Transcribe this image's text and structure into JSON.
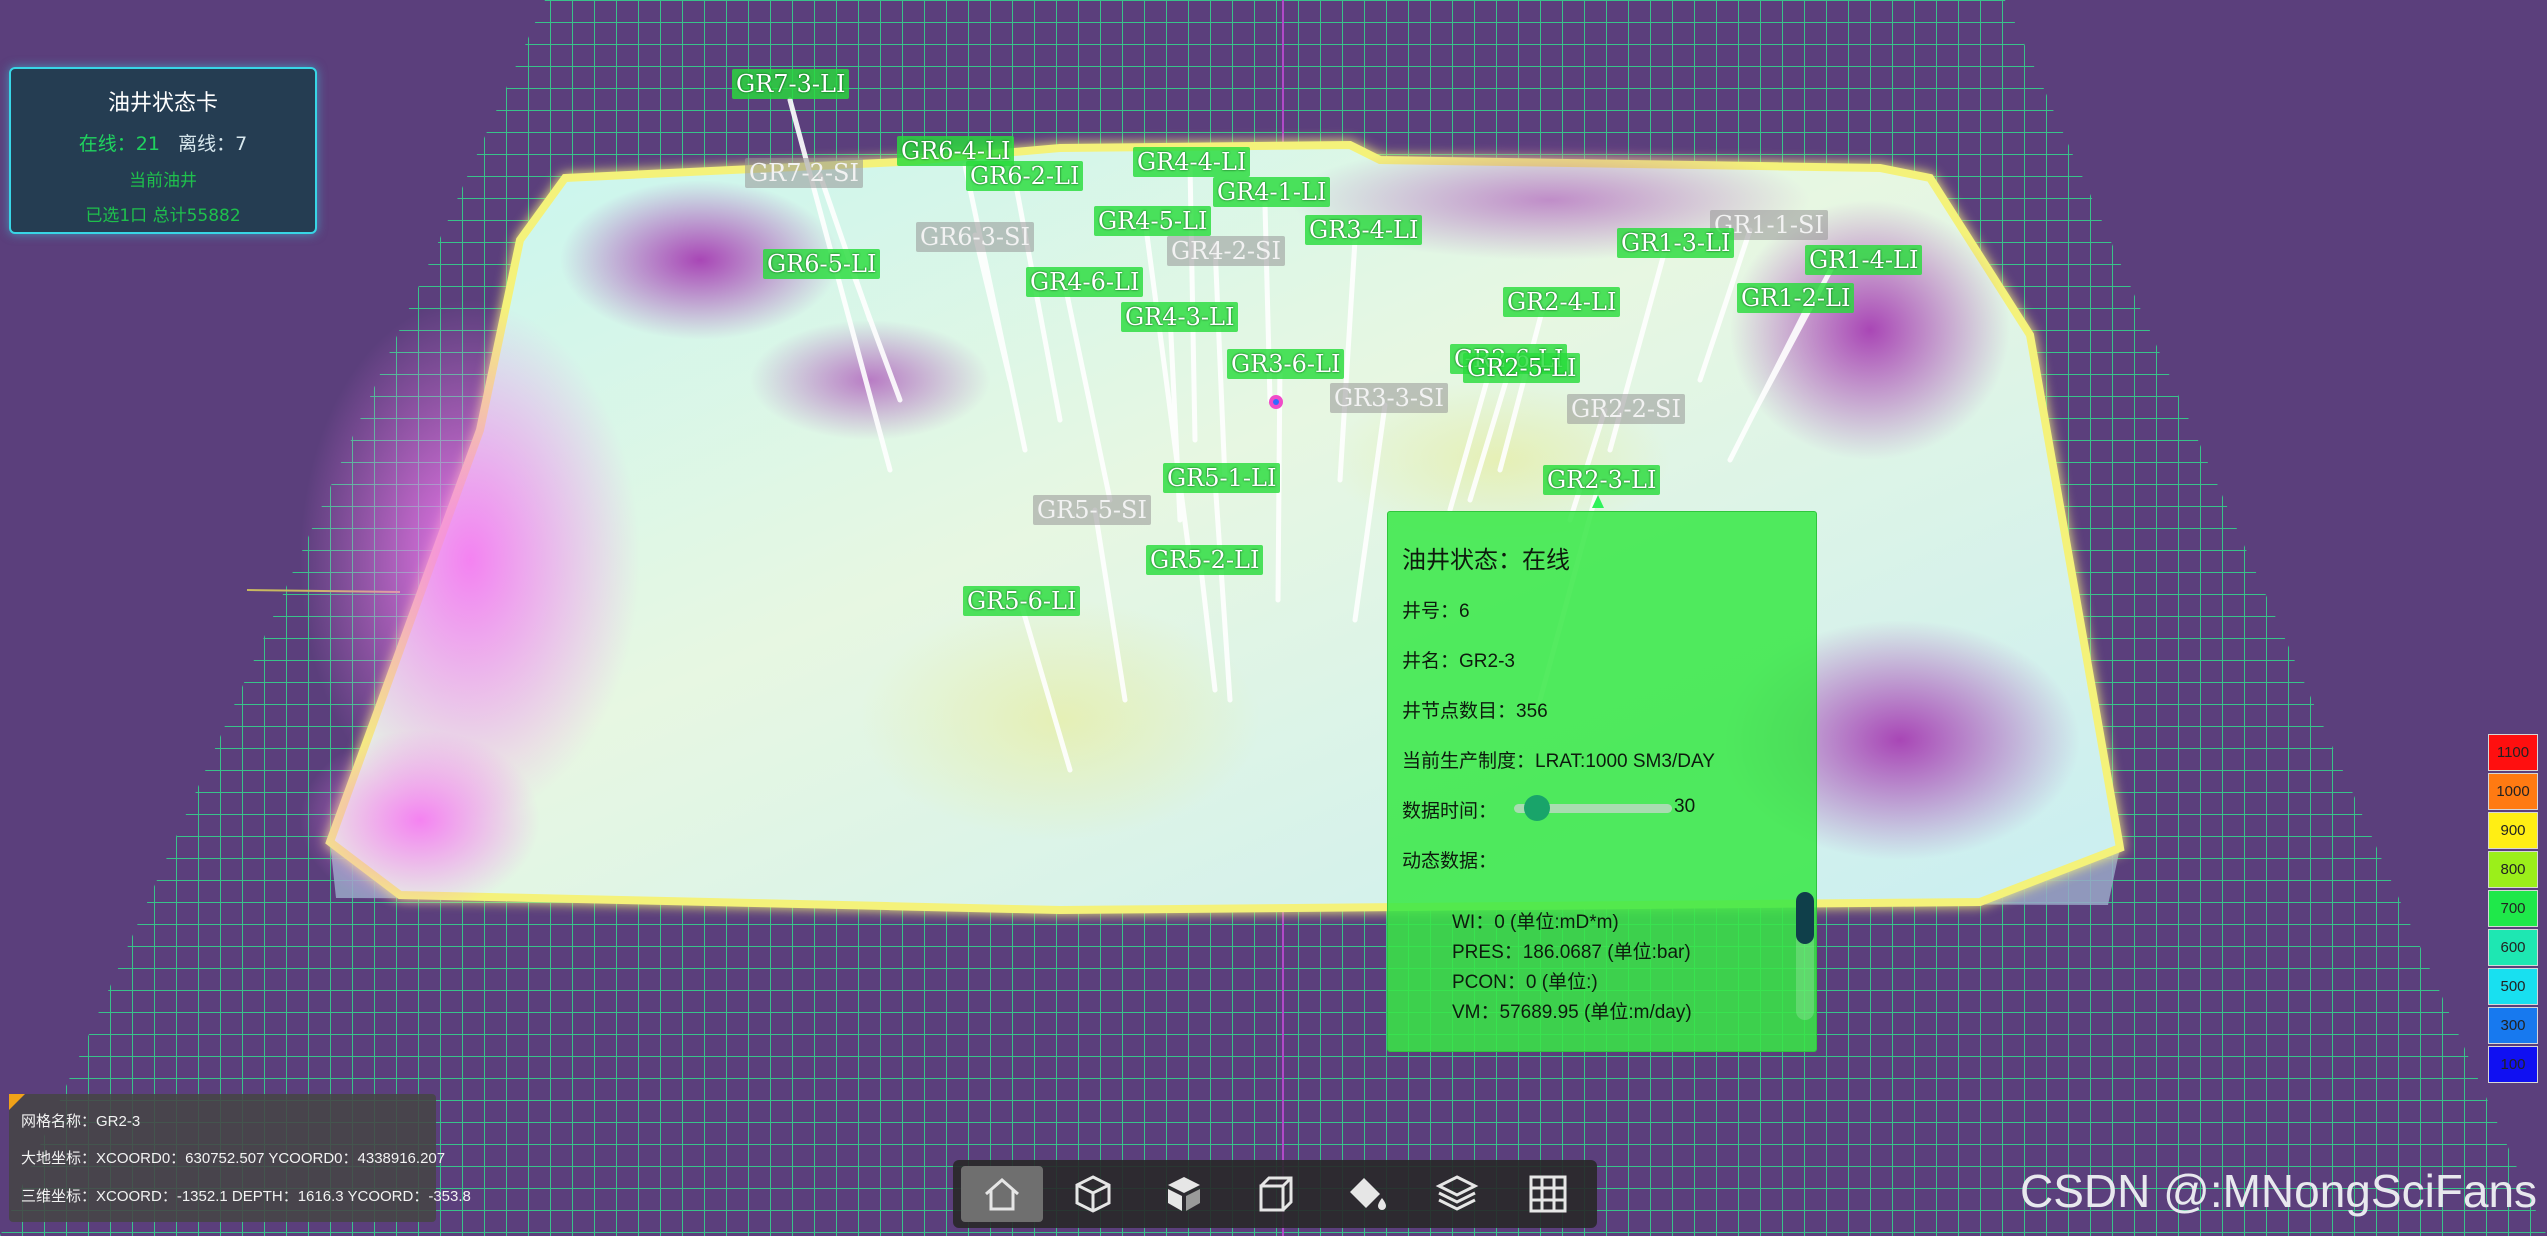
{
  "status_card": {
    "title": "油井状态卡",
    "online_label": "在线：",
    "online_count": "21",
    "offline_label": "离线：",
    "offline_count": "7",
    "line2": "当前油井",
    "line3": "已选1口  总计55882"
  },
  "well_labels": [
    {
      "name": "GR7-3-LI",
      "style": "lg"
    },
    {
      "name": "GR7-2-SI",
      "style": "sg"
    },
    {
      "name": "GR6-4-LI",
      "style": "lg"
    },
    {
      "name": "GR6-2-LI",
      "style": "lg"
    },
    {
      "name": "GR6-3-SI",
      "style": "sg"
    },
    {
      "name": "GR6-5-LI",
      "style": "lg"
    },
    {
      "name": "GR4-4-LI",
      "style": "lg"
    },
    {
      "name": "GR4-1-LI",
      "style": "lg"
    },
    {
      "name": "GR4-5-LI",
      "style": "lg"
    },
    {
      "name": "GR4-2-SI",
      "style": "sg"
    },
    {
      "name": "GR3-4-LI",
      "style": "lg"
    },
    {
      "name": "GR4-6-LI",
      "style": "lg"
    },
    {
      "name": "GR4-3-LI",
      "style": "lg"
    },
    {
      "name": "GR3-6-LI",
      "style": "lg"
    },
    {
      "name": "GR3-3-SI",
      "style": "sg"
    },
    {
      "name": "GR1-1-SI",
      "style": "sg"
    },
    {
      "name": "GR1-3-LI",
      "style": "lg"
    },
    {
      "name": "GR1-4-LI",
      "style": "lg"
    },
    {
      "name": "GR1-2-LI",
      "style": "lg"
    },
    {
      "name": "GR2-4-LI",
      "style": "lg"
    },
    {
      "name": "GR2-6-LI",
      "style": "lg"
    },
    {
      "name": "GR2-5-LI",
      "style": "lg"
    },
    {
      "name": "GR2-2-SI",
      "style": "sg"
    },
    {
      "name": "GR2-3-LI",
      "style": "lg"
    },
    {
      "name": "GR5-1-LI",
      "style": "lg"
    },
    {
      "name": "GR5-5-SI",
      "style": "sg"
    },
    {
      "name": "GR5-2-LI",
      "style": "lg"
    },
    {
      "name": "GR5-6-LI",
      "style": "lg"
    }
  ],
  "well_popup": {
    "status": "油井状态：在线",
    "well_no": "井号：6",
    "well_name": "井名：GR2-3",
    "node_count": "井节点数目：356",
    "production": "当前生产制度：LRAT:1000 SM3/DAY",
    "time_label": "数据时间：",
    "time_value": "30",
    "time_fraction": 0.05,
    "dynamic_label": "动态数据：",
    "dynamic_items": [
      "WI：0 (单位:mD*m)",
      "PRES：186.0687 (单位:bar)",
      "PCON：0 (单位:)",
      "VM：57689.95 (单位:m/day)"
    ]
  },
  "legend": [
    {
      "value": "1100",
      "color": "#ff0f0f"
    },
    {
      "value": "1000",
      "color": "#ff7a12"
    },
    {
      "value": "900",
      "color": "#ffee14"
    },
    {
      "value": "800",
      "color": "#9bef1a"
    },
    {
      "value": "700",
      "color": "#1fe84a"
    },
    {
      "value": "600",
      "color": "#1ee7b2"
    },
    {
      "value": "500",
      "color": "#18e0f0"
    },
    {
      "value": "300",
      "color": "#1779ef"
    },
    {
      "value": "100",
      "color": "#1010f2"
    }
  ],
  "grid_info": {
    "grid_name": "网格名称：GR2-3",
    "geo_coords": "大地坐标：XCOORD0：630752.507 YCOORD0：4338916.207",
    "xyz_coords": "三维坐标：XCOORD：-1352.1 DEPTH：1616.3 YCOORD：-353.8"
  },
  "toolbar": {
    "buttons": [
      "home-icon",
      "cube-icon",
      "isometric-view-icon",
      "box-outline-icon",
      "paint-bucket-icon",
      "layers-icon",
      "grid-icon"
    ]
  },
  "watermark": "CSDN @:MNongSciFans"
}
